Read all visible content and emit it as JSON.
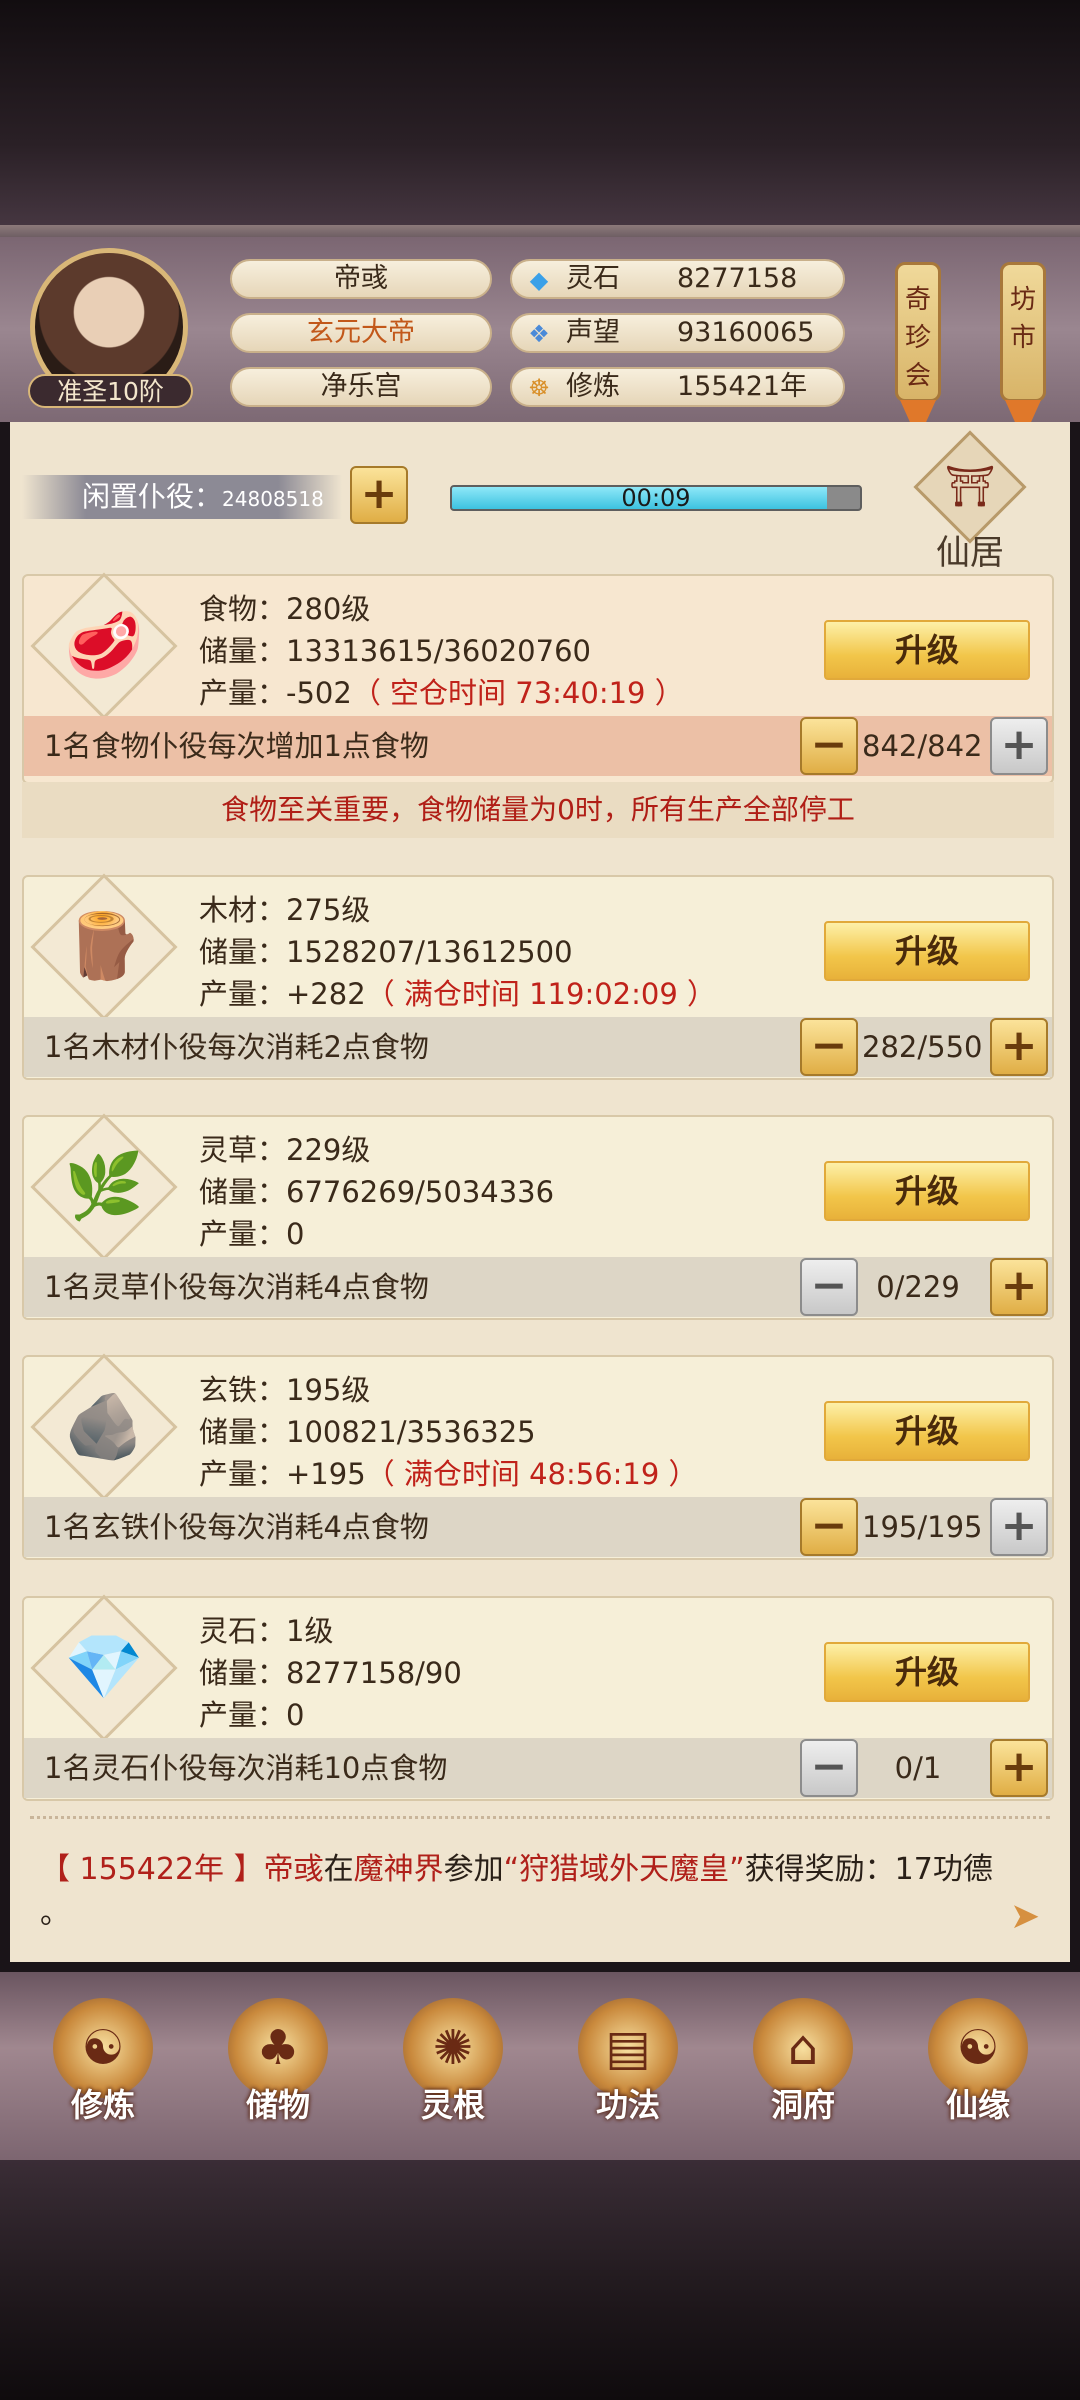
{
  "header": {
    "name": "帝彧",
    "title": "玄元大帝",
    "palace": "净乐宫",
    "rank": "准圣10阶",
    "resources": [
      {
        "icon": "spirit-stone-icon",
        "glyph": "◆",
        "label": "灵石",
        "value": "8277158",
        "color": "#3aa0e8"
      },
      {
        "icon": "prestige-icon",
        "glyph": "❖",
        "label": "声望",
        "value": "93160065",
        "color": "#4a8ad8"
      },
      {
        "icon": "cultivation-icon",
        "glyph": "☸",
        "label": "修炼",
        "value": "155421年",
        "color": "#d9902a"
      }
    ],
    "lanterns": [
      {
        "label": "奇珍会",
        "chars": "奇珍会"
      },
      {
        "label": "坊市",
        "chars": "坊市"
      }
    ]
  },
  "idle": {
    "label": "闲置仆役：",
    "count": "24808518",
    "add_label": "+",
    "timer": "00:09",
    "progress": 0.92
  },
  "residence_label": "仙居",
  "resources": [
    {
      "key": "food",
      "glyph": "🥩",
      "level": "食物：280级",
      "storage": "储量：13313615/36020760",
      "output_label": "产量：-502",
      "output_extra": "（ 空仓时间 73:40:19 ）",
      "upgrade": "升级",
      "worker_text": "1名食物仆役每次增加1点食物",
      "workers": "842/842",
      "minus_active": true,
      "plus_active": false
    },
    {
      "key": "wood",
      "glyph": "🪵",
      "level": "木材：275级",
      "storage": "储量：1528207/13612500",
      "output_label": "产量：+282",
      "output_extra": "（ 满仓时间 119:02:09 ）",
      "upgrade": "升级",
      "worker_text": "1名木材仆役每次消耗2点食物",
      "workers": "282/550",
      "minus_active": true,
      "plus_active": true
    },
    {
      "key": "herb",
      "glyph": "🌿",
      "level": "灵草：229级",
      "storage": "储量：6776269/5034336",
      "output_label": "产量：0",
      "output_extra": "",
      "upgrade": "升级",
      "worker_text": "1名灵草仆役每次消耗4点食物",
      "workers": "0/229",
      "minus_active": false,
      "plus_active": true
    },
    {
      "key": "iron",
      "glyph": "🪨",
      "level": "玄铁：195级",
      "storage": "储量：100821/3536325",
      "output_label": "产量：+195",
      "output_extra": "（ 满仓时间 48:56:19 ）",
      "upgrade": "升级",
      "worker_text": "1名玄铁仆役每次消耗4点食物",
      "workers": "195/195",
      "minus_active": true,
      "plus_active": false
    },
    {
      "key": "stone",
      "glyph": "💎",
      "level": "灵石：1级",
      "storage": "储量：8277158/90",
      "output_label": "产量：0",
      "output_extra": "",
      "upgrade": "升级",
      "worker_text": "1名灵石仆役每次消耗10点食物",
      "workers": "0/1",
      "minus_active": false,
      "plus_active": true
    }
  ],
  "warning": "食物至关重要，食物储量为0时，所有生产全部停工",
  "event": {
    "year": "【 155422年 】",
    "name": "帝彧",
    "mid1": "在",
    "place": "魔神界",
    "mid2": "参加",
    "task": "“狩猎域外天魔皇”",
    "tail": "获得奖励：17功德 。"
  },
  "nav": [
    {
      "label": "修炼",
      "glyph": "☯"
    },
    {
      "label": "储物",
      "glyph": "♣"
    },
    {
      "label": "灵根",
      "glyph": "✺"
    },
    {
      "label": "功法",
      "glyph": "▤"
    },
    {
      "label": "洞府",
      "glyph": "⌂"
    },
    {
      "label": "仙缘",
      "glyph": "☯"
    }
  ]
}
